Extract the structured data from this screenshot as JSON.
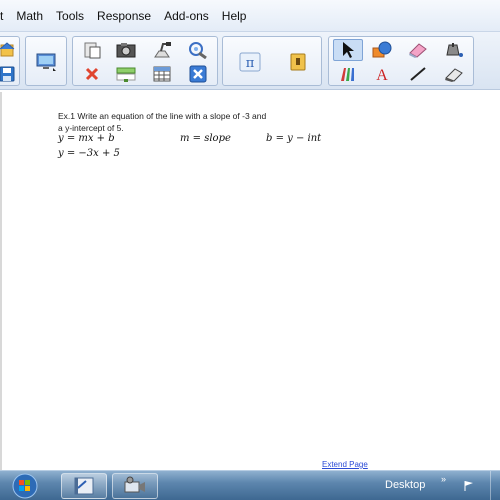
{
  "menu": [
    "t",
    "Math",
    "Tools",
    "Response",
    "Add-ons",
    "Help"
  ],
  "page": {
    "prompt_line1": "Ex.1 Write an equation of the line with a slope of -3 and",
    "prompt_line2": "a y-intercept of 5.",
    "eq_slope_intercept": "y = mx + b",
    "eq_m": "m = slope",
    "eq_b": "b = y − int",
    "eq_answer": "y = −3x + 5",
    "extend_link": "Extend Page"
  },
  "taskbar": {
    "desktop_label": "Desktop",
    "chevron": "»"
  },
  "colors": {
    "accent_blue": "#2b4bd6",
    "taskbar": "#4f7aa3"
  },
  "icons": [
    "home-icon",
    "save-icon",
    "display-icon",
    "paste-icon",
    "delete-icon",
    "camera-icon",
    "screen-shade-icon",
    "document-camera-icon",
    "table-icon",
    "magic-pen-icon",
    "close-box-icon",
    "pi-icon",
    "gallery-icon",
    "select-arrow-icon",
    "shapes-icon",
    "eraser-icon",
    "fill-icon",
    "pens-icon",
    "text-icon",
    "line-icon",
    "eraser-tool-icon"
  ]
}
